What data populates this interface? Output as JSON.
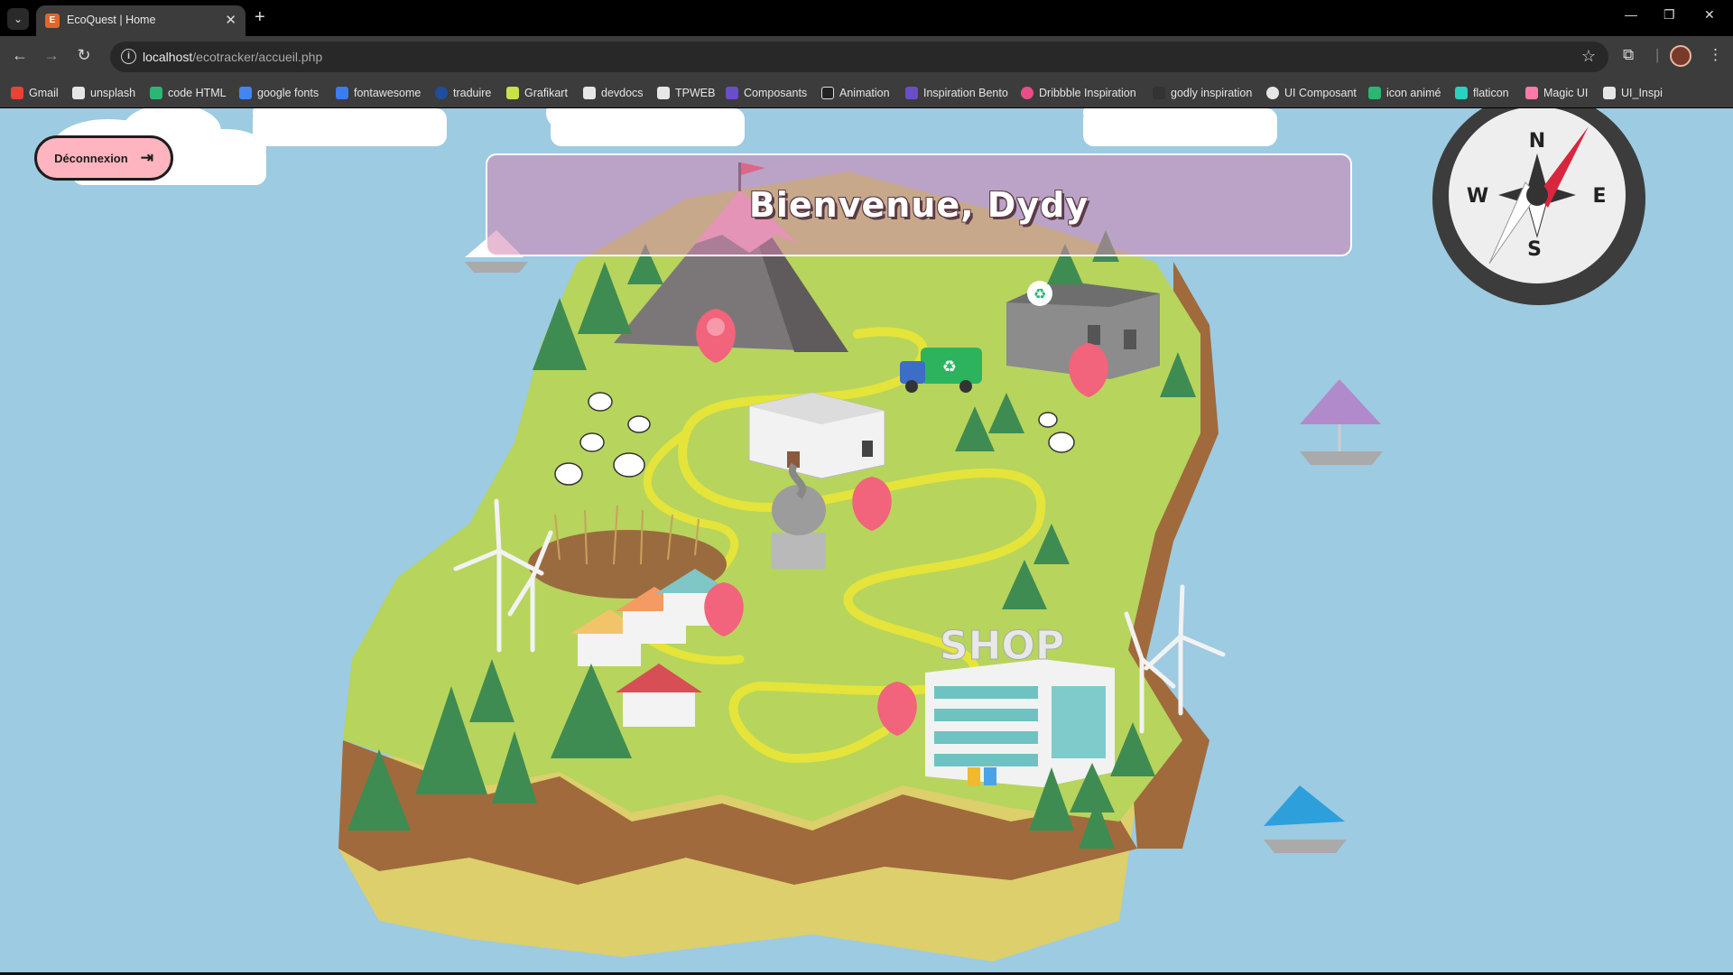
{
  "browser": {
    "tab_title": "EcoQuest | Home",
    "tab_favicon": "chrome-favicon",
    "url_host": "localhost",
    "url_path": "/ecotracker/accueil.php",
    "bookmarks": [
      {
        "label": "Gmail",
        "color": "#ea4335"
      },
      {
        "label": "unsplash",
        "color": "#e6e6e6"
      },
      {
        "label": "code HTML",
        "color": "#2bb673"
      },
      {
        "label": "google fonts",
        "color": "#4285f4"
      },
      {
        "label": "fontawesome",
        "color": "#3c7bf0"
      },
      {
        "label": "traduire",
        "color": "#1d4f9e"
      },
      {
        "label": "Grafikart",
        "color": "#c8e04a"
      },
      {
        "label": "devdocs",
        "color": "#e6e6e6"
      },
      {
        "label": "TPWEB",
        "color": "#e6e6e6"
      },
      {
        "label": "Composants",
        "color": "#6a4ec9"
      },
      {
        "label": "Animation",
        "color": "#222222"
      },
      {
        "label": "Inspiration Bento",
        "color": "#6a4ec9"
      },
      {
        "label": "Dribbble Inspiration",
        "color": "#ea4c89"
      },
      {
        "label": "godly inspiration",
        "color": "#333333"
      },
      {
        "label": "UI Composant",
        "color": "#e6e6e6"
      },
      {
        "label": "icon animé",
        "color": "#2bb673"
      },
      {
        "label": "flaticon",
        "color": "#2ad0c0"
      },
      {
        "label": "Magic UI",
        "color": "#ff7aa8"
      },
      {
        "label": "UI_Inspi",
        "color": "#e6e6e6"
      }
    ]
  },
  "page": {
    "logout_label": "Déconnexion",
    "welcome_title": "Bienvenue, Dydy",
    "shop_sign": "SHOP",
    "compass": {
      "n": "N",
      "e": "E",
      "s": "S",
      "w": "W"
    }
  },
  "colors": {
    "sea": "#9ccbe2",
    "grass": "#b7d45d",
    "cliff": "#a06a3c",
    "sand": "#dccf6c",
    "pin": "#f2637c",
    "path": "#e5e43a",
    "logout_bg": "#ffb5bf",
    "welcome_bg": "#d583b0"
  },
  "map_pins": [
    {
      "name": "mountain-pin"
    },
    {
      "name": "recycling-center-pin"
    },
    {
      "name": "statue-pin"
    },
    {
      "name": "village-pin"
    },
    {
      "name": "shop-pin"
    }
  ]
}
